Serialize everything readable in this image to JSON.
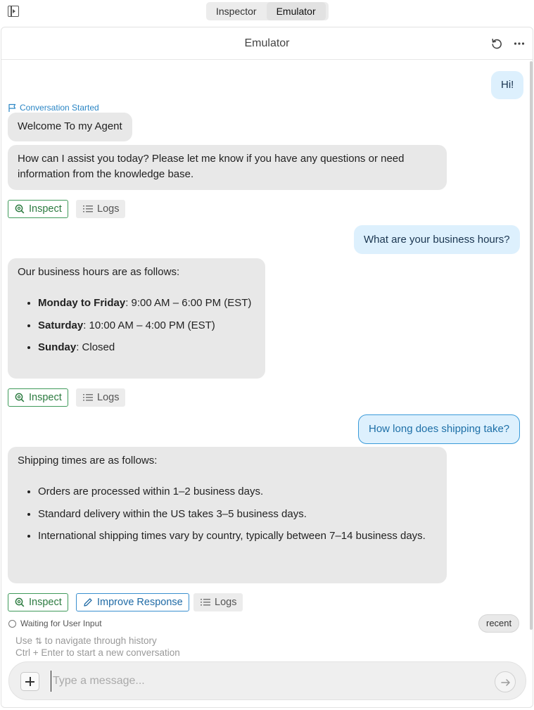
{
  "tabs": [
    {
      "label": "Inspector",
      "active": false
    },
    {
      "label": "Emulator",
      "active": true
    }
  ],
  "header": {
    "title": "Emulator"
  },
  "status": {
    "conversation_started": "Conversation Started",
    "waiting": "Waiting for User Input"
  },
  "messages": {
    "user1": "Hi!",
    "bot1": "Welcome To my Agent",
    "bot2": "How can I assist you today? Please let me know if you have any questions or need information from the knowledge base.",
    "user2": "What are your business hours?",
    "bot3": {
      "intro": "Our business hours are as follows:",
      "items": [
        {
          "bold": "Monday to Friday",
          "text": ": 9:00 AM – 6:00 PM (EST)"
        },
        {
          "bold": "Saturday",
          "text": ": 10:00 AM – 4:00 PM (EST)"
        },
        {
          "bold": "Sunday",
          "text": ": Closed"
        }
      ]
    },
    "user3": "How long does shipping take?",
    "bot4": {
      "intro": "Shipping times are as follows:",
      "items": [
        "Orders are processed within 1–2 business days.",
        "Standard delivery within the US takes 3–5 business days.",
        "International shipping times vary by country, typically between 7–14 business days."
      ]
    }
  },
  "actions": {
    "inspect": "Inspect",
    "logs": "Logs",
    "improve": "Improve Response"
  },
  "recent_label": "recent",
  "hints": {
    "history_pre": "Use",
    "history_post": "to navigate through history",
    "new_conversation": "Ctrl + Enter to start a new conversation"
  },
  "input": {
    "placeholder": "Type a message...",
    "value": ""
  },
  "colors": {
    "user_bubble": "#ddf0fd",
    "bot_bubble": "#e8e8e8",
    "inspect_green": "#2b7a3f",
    "improve_blue": "#1f6aa5",
    "link_blue": "#2b86c5"
  }
}
